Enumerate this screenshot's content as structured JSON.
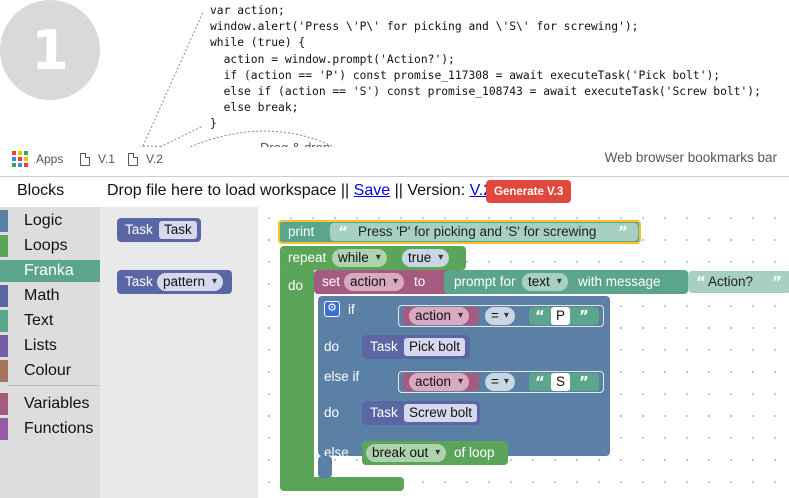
{
  "step_number": "1",
  "code_lines": [
    "var action;",
    "window.alert('Press \\'P\\' for picking and \\'S\\' for screwing');",
    "while (true) {",
    "  action = window.prompt('Action?');",
    "  if (action == 'P') const promise_117308 = await executeTask('Pick bolt');",
    "  else if (action == 'S') const promise_108743 = await executeTask('Screw bolt');",
    "  else break;",
    "}"
  ],
  "annotations": {
    "drag_drop": "Drag & drop",
    "bookmarks_caption": "Web browser bookmarks bar"
  },
  "bookmarks": {
    "apps": "Apps",
    "v1": "V.1",
    "v2": "V.2"
  },
  "toolbar": {
    "blocks_title": "Blocks",
    "drop_text": "Drop file here to load workspace || ",
    "save_link": "Save",
    "version_sep": " || Version: ",
    "version_link": "V.2",
    "generate_button": "Generate V.3"
  },
  "categories": [
    {
      "label": "Logic",
      "color": "#5b80a5"
    },
    {
      "label": "Loops",
      "color": "#5ba55b"
    },
    {
      "label": "Franka",
      "color": "#5ba58c",
      "selected": true
    },
    {
      "label": "Math",
      "color": "#5b67a5"
    },
    {
      "label": "Text",
      "color": "#5ba58c"
    },
    {
      "label": "Lists",
      "color": "#745ba5"
    },
    {
      "label": "Colour",
      "color": "#a5745b"
    },
    {
      "label": "Variables",
      "color": "#a55b80"
    },
    {
      "label": "Functions",
      "color": "#995ba5"
    }
  ],
  "flyout": {
    "task1_label": "Task",
    "task1_value": "Task",
    "task2_label": "Task",
    "task2_value": "pattern"
  },
  "workspace": {
    "print_kw": "print",
    "print_text": "Press 'P' for picking and 'S' for screwing",
    "repeat_kw": "repeat",
    "repeat_mode": "while",
    "repeat_cond": "true",
    "do_kw": "do",
    "set_kw": "set",
    "set_var": "action",
    "to_kw": "to",
    "prompt_kw": "prompt for",
    "prompt_type": "text",
    "with_message": "with message",
    "prompt_msg": "Action?",
    "if_kw": "if",
    "if_var": "action",
    "if_op": "=",
    "if_val": "P",
    "do1_kw": "do",
    "task1_kw": "Task",
    "task1_val": "Pick bolt",
    "elseif_kw": "else if",
    "elseif_var": "action",
    "elseif_op": "=",
    "elseif_val": "S",
    "do2_kw": "do",
    "task2_kw": "Task",
    "task2_val": "Screw bolt",
    "else_kw": "else",
    "break_mode": "break out",
    "of_loop": "of loop",
    "quote": "“”"
  },
  "colors": {
    "logic": "#5b80a5",
    "loops": "#5ba55b",
    "text": "#5ba58c",
    "variables": "#a55b80",
    "franka": "#5b67a5",
    "print_highlight": "#fbc02d",
    "generate": "#e2473d"
  },
  "icons": {
    "apps": "apps-grid-icon",
    "bookmark": "file-icon",
    "mutator": "gear-icon"
  }
}
